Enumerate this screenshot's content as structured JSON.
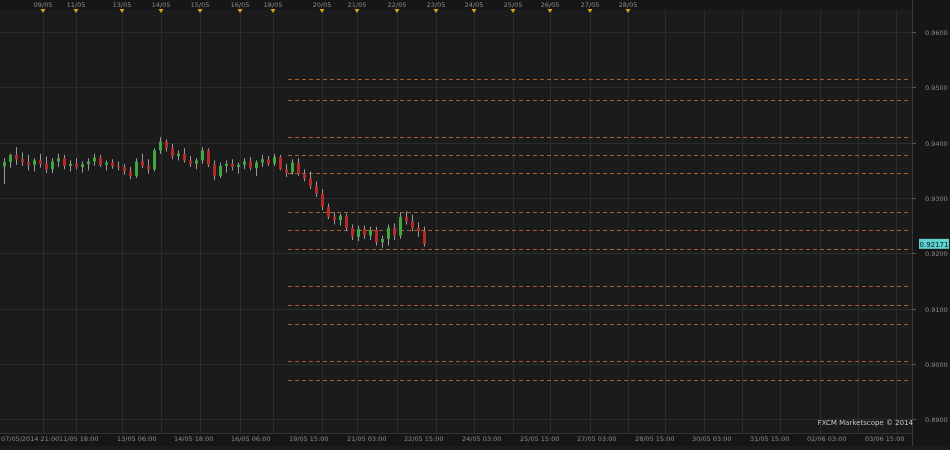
{
  "chart_data": {
    "type": "candlestick",
    "title": "",
    "xlabel": "",
    "ylabel": "",
    "ylim": [
      0.8875,
      0.964
    ],
    "y_ticks": [
      "0.9600",
      "0.9500",
      "0.9400",
      "0.9300",
      "0.9200",
      "0.9100",
      "0.9000",
      "0.8900"
    ],
    "current_price": "0.92171",
    "top_date_labels": [
      "09/05",
      "11/05",
      "13/05",
      "14/05",
      "15/05",
      "16/05",
      "18/05",
      "20/05",
      "21/05",
      "22/05",
      "23/05",
      "24/05",
      "25/05",
      "26/05",
      "27/05",
      "28/05"
    ],
    "bottom_time_labels": [
      "07/05/2014 21:00",
      "11/05 18:00",
      "13/05 06:00",
      "14/05 18:00",
      "16/05 06:00",
      "19/05 15:00",
      "21/05 03:00",
      "22/05 15:00",
      "24/05 03:00",
      "25/05 15:00",
      "27/05 03:00",
      "28/05 15:00",
      "30/05 03:00",
      "31/05 15:00",
      "02/06 03:00",
      "03/06 15:00"
    ],
    "horizontal_levels": [
      0.9515,
      0.9478,
      0.941,
      0.9378,
      0.9345,
      0.9275,
      0.9242,
      0.9207,
      0.914,
      0.9107,
      0.9073,
      0.9006,
      0.8971
    ],
    "candles": [
      {
        "o": 0.9357,
        "h": 0.9372,
        "l": 0.9325,
        "c": 0.9365
      },
      {
        "o": 0.9365,
        "h": 0.938,
        "l": 0.9355,
        "c": 0.9378
      },
      {
        "o": 0.9378,
        "h": 0.9392,
        "l": 0.936,
        "c": 0.937
      },
      {
        "o": 0.937,
        "h": 0.9382,
        "l": 0.9358,
        "c": 0.9365
      },
      {
        "o": 0.9365,
        "h": 0.9378,
        "l": 0.935,
        "c": 0.936
      },
      {
        "o": 0.936,
        "h": 0.9372,
        "l": 0.9348,
        "c": 0.9368
      },
      {
        "o": 0.9368,
        "h": 0.938,
        "l": 0.9355,
        "c": 0.9362
      },
      {
        "o": 0.9362,
        "h": 0.9375,
        "l": 0.9345,
        "c": 0.9352
      },
      {
        "o": 0.9352,
        "h": 0.9372,
        "l": 0.9345,
        "c": 0.9366
      },
      {
        "o": 0.9366,
        "h": 0.938,
        "l": 0.9356,
        "c": 0.9372
      },
      {
        "o": 0.9372,
        "h": 0.9378,
        "l": 0.9352,
        "c": 0.9358
      },
      {
        "o": 0.9358,
        "h": 0.9368,
        "l": 0.9348,
        "c": 0.9362
      },
      {
        "o": 0.9362,
        "h": 0.9372,
        "l": 0.9352,
        "c": 0.9356
      },
      {
        "o": 0.9356,
        "h": 0.9366,
        "l": 0.9346,
        "c": 0.9361
      },
      {
        "o": 0.9361,
        "h": 0.9372,
        "l": 0.935,
        "c": 0.9366
      },
      {
        "o": 0.9366,
        "h": 0.938,
        "l": 0.9358,
        "c": 0.9373
      },
      {
        "o": 0.9373,
        "h": 0.9378,
        "l": 0.9356,
        "c": 0.936
      },
      {
        "o": 0.936,
        "h": 0.9368,
        "l": 0.935,
        "c": 0.9364
      },
      {
        "o": 0.9364,
        "h": 0.937,
        "l": 0.9353,
        "c": 0.9358
      },
      {
        "o": 0.9358,
        "h": 0.9366,
        "l": 0.935,
        "c": 0.9356
      },
      {
        "o": 0.9356,
        "h": 0.9362,
        "l": 0.9342,
        "c": 0.9348
      },
      {
        "o": 0.9348,
        "h": 0.9356,
        "l": 0.9334,
        "c": 0.934
      },
      {
        "o": 0.934,
        "h": 0.9372,
        "l": 0.9336,
        "c": 0.9366
      },
      {
        "o": 0.9366,
        "h": 0.938,
        "l": 0.9354,
        "c": 0.9358
      },
      {
        "o": 0.9358,
        "h": 0.937,
        "l": 0.9344,
        "c": 0.9352
      },
      {
        "o": 0.9352,
        "h": 0.939,
        "l": 0.9348,
        "c": 0.9386
      },
      {
        "o": 0.9386,
        "h": 0.941,
        "l": 0.938,
        "c": 0.9402
      },
      {
        "o": 0.9402,
        "h": 0.9406,
        "l": 0.9384,
        "c": 0.939
      },
      {
        "o": 0.939,
        "h": 0.9398,
        "l": 0.937,
        "c": 0.9376
      },
      {
        "o": 0.9376,
        "h": 0.9386,
        "l": 0.9368,
        "c": 0.938
      },
      {
        "o": 0.938,
        "h": 0.939,
        "l": 0.9364,
        "c": 0.9368
      },
      {
        "o": 0.9368,
        "h": 0.9376,
        "l": 0.9356,
        "c": 0.9362
      },
      {
        "o": 0.9362,
        "h": 0.9372,
        "l": 0.9352,
        "c": 0.9368
      },
      {
        "o": 0.9368,
        "h": 0.9392,
        "l": 0.9362,
        "c": 0.9386
      },
      {
        "o": 0.9386,
        "h": 0.939,
        "l": 0.9356,
        "c": 0.936
      },
      {
        "o": 0.936,
        "h": 0.9368,
        "l": 0.9332,
        "c": 0.934
      },
      {
        "o": 0.934,
        "h": 0.9364,
        "l": 0.9336,
        "c": 0.9358
      },
      {
        "o": 0.9358,
        "h": 0.9368,
        "l": 0.9346,
        "c": 0.9362
      },
      {
        "o": 0.9362,
        "h": 0.937,
        "l": 0.935,
        "c": 0.9356
      },
      {
        "o": 0.9356,
        "h": 0.9364,
        "l": 0.9344,
        "c": 0.936
      },
      {
        "o": 0.936,
        "h": 0.9372,
        "l": 0.9352,
        "c": 0.9366
      },
      {
        "o": 0.9366,
        "h": 0.9374,
        "l": 0.935,
        "c": 0.9354
      },
      {
        "o": 0.9354,
        "h": 0.9368,
        "l": 0.934,
        "c": 0.9364
      },
      {
        "o": 0.9364,
        "h": 0.9378,
        "l": 0.9356,
        "c": 0.937
      },
      {
        "o": 0.937,
        "h": 0.9376,
        "l": 0.9358,
        "c": 0.9362
      },
      {
        "o": 0.9362,
        "h": 0.938,
        "l": 0.9358,
        "c": 0.9374
      },
      {
        "o": 0.9374,
        "h": 0.9378,
        "l": 0.935,
        "c": 0.9352
      },
      {
        "o": 0.9352,
        "h": 0.9362,
        "l": 0.9338,
        "c": 0.9346
      },
      {
        "o": 0.9346,
        "h": 0.937,
        "l": 0.9342,
        "c": 0.9364
      },
      {
        "o": 0.9364,
        "h": 0.9372,
        "l": 0.934,
        "c": 0.9344
      },
      {
        "o": 0.9344,
        "h": 0.9352,
        "l": 0.933,
        "c": 0.9336
      },
      {
        "o": 0.9336,
        "h": 0.9348,
        "l": 0.9316,
        "c": 0.9322
      },
      {
        "o": 0.9322,
        "h": 0.933,
        "l": 0.9302,
        "c": 0.9308
      },
      {
        "o": 0.9308,
        "h": 0.9316,
        "l": 0.9278,
        "c": 0.9284
      },
      {
        "o": 0.9284,
        "h": 0.929,
        "l": 0.9262,
        "c": 0.9266
      },
      {
        "o": 0.9266,
        "h": 0.9274,
        "l": 0.9252,
        "c": 0.926
      },
      {
        "o": 0.926,
        "h": 0.9272,
        "l": 0.925,
        "c": 0.9268
      },
      {
        "o": 0.9268,
        "h": 0.9272,
        "l": 0.924,
        "c": 0.9246
      },
      {
        "o": 0.9246,
        "h": 0.9252,
        "l": 0.9224,
        "c": 0.923
      },
      {
        "o": 0.923,
        "h": 0.925,
        "l": 0.9222,
        "c": 0.9244
      },
      {
        "o": 0.9244,
        "h": 0.925,
        "l": 0.9226,
        "c": 0.9232
      },
      {
        "o": 0.9232,
        "h": 0.9248,
        "l": 0.9224,
        "c": 0.9242
      },
      {
        "o": 0.9242,
        "h": 0.9248,
        "l": 0.9214,
        "c": 0.922
      },
      {
        "o": 0.922,
        "h": 0.9232,
        "l": 0.921,
        "c": 0.9226
      },
      {
        "o": 0.9226,
        "h": 0.9252,
        "l": 0.9214,
        "c": 0.9246
      },
      {
        "o": 0.9246,
        "h": 0.9254,
        "l": 0.9224,
        "c": 0.9232
      },
      {
        "o": 0.9232,
        "h": 0.9274,
        "l": 0.9226,
        "c": 0.9266
      },
      {
        "o": 0.9266,
        "h": 0.9276,
        "l": 0.9252,
        "c": 0.9258
      },
      {
        "o": 0.9258,
        "h": 0.927,
        "l": 0.924,
        "c": 0.9246
      },
      {
        "o": 0.9246,
        "h": 0.9256,
        "l": 0.923,
        "c": 0.924
      },
      {
        "o": 0.924,
        "h": 0.9248,
        "l": 0.9212,
        "c": 0.9217
      }
    ],
    "grid": true,
    "watermark": "FXCM Marketscope © 2014",
    "colors": {
      "background": "#1b1b1b",
      "grid": "#2c2c2c",
      "bull": "#3fa83a",
      "bear": "#b42a2a",
      "level": "#c8692c",
      "current_price_bg": "#5fd3cf",
      "marker": "#d9a51c",
      "text": "#8d8d8d",
      "axis_panel": "#1f1f1f"
    }
  }
}
